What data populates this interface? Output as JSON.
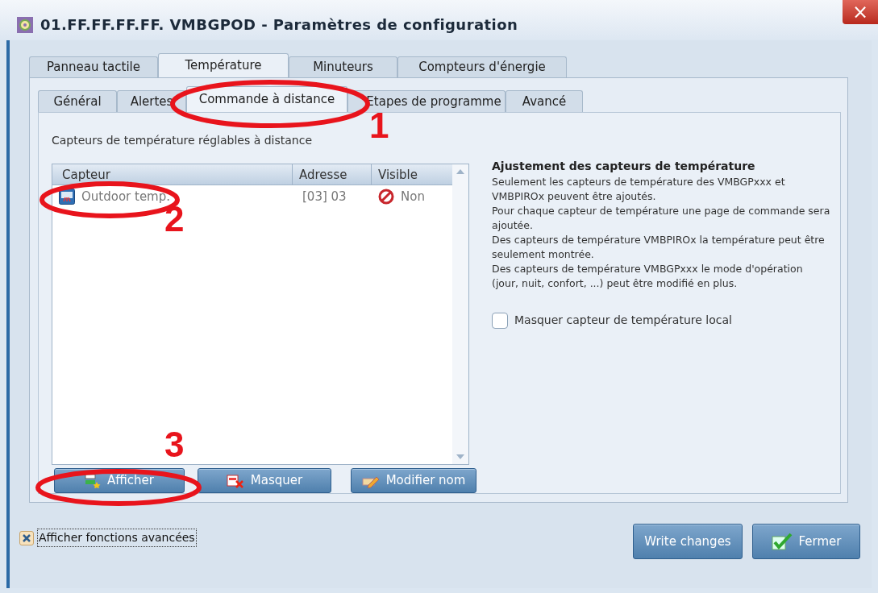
{
  "window": {
    "title": "01.FF.FF.FF.FF. VMBGPOD - Paramètres de configuration",
    "close": "×"
  },
  "tabs": [
    {
      "label": "Panneau tactile",
      "selected": false
    },
    {
      "label": "Température",
      "selected": true
    },
    {
      "label": "Minuteurs",
      "selected": false
    },
    {
      "label": "Compteurs d'énergie",
      "selected": false
    }
  ],
  "subtabs": [
    {
      "label": "Général",
      "selected": false
    },
    {
      "label": "Alertes",
      "selected": false
    },
    {
      "label": "Commande à distance",
      "selected": true
    },
    {
      "label": "Etapes de programme",
      "selected": false
    },
    {
      "label": "Avancé",
      "selected": false
    }
  ],
  "section_label": "Capteurs de température réglables à distance",
  "table": {
    "columns": [
      "Capteur",
      "Adresse",
      "Visible"
    ],
    "rows": [
      {
        "name": "Outdoor temp.",
        "address": "[03] 03",
        "visible": false,
        "visible_text": "Non"
      }
    ]
  },
  "list_buttons": [
    {
      "label": "Afficher",
      "kind": "show"
    },
    {
      "label": "Masquer",
      "kind": "hide"
    },
    {
      "label": "Modifier nom",
      "kind": "rename"
    }
  ],
  "help": {
    "title": "Ajustement des capteurs de température",
    "lines": [
      "Seulement les capteurs de température des VMBGPxxx et VMBPIROx peuvent être ajoutés.",
      "Pour chaque capteur de température une page de commande sera ajoutée.",
      "Des capteurs de température VMBPIROx la température peut être seulement montrée.",
      "Des capteurs de température VMBGPxxx le mode d'opération (jour, nuit, confort, ...) peut être modifié en plus."
    ]
  },
  "hide_local": {
    "label": "Masquer capteur de température local",
    "checked": false
  },
  "advanced": {
    "label": "Afficher fonctions avancées",
    "checked": true
  },
  "footer_buttons": [
    {
      "label": "Write changes",
      "kind": "plain"
    },
    {
      "label": "Fermer",
      "kind": "close"
    }
  ],
  "annotations": [
    {
      "label": "1"
    },
    {
      "label": "2"
    },
    {
      "label": "3"
    }
  ]
}
